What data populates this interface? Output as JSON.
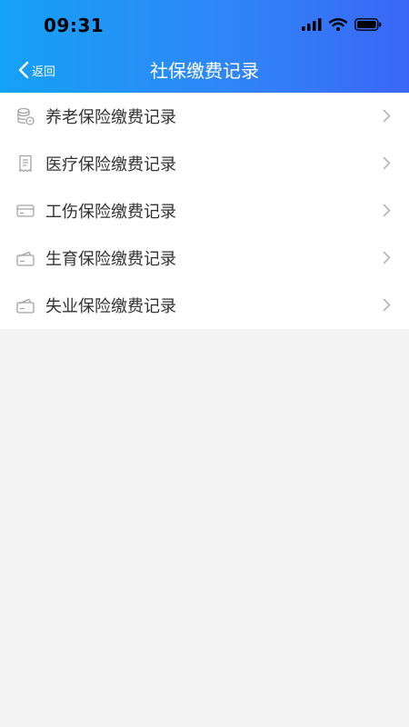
{
  "status_bar": {
    "time": "09:31",
    "icons": [
      "signal-icon",
      "wifi-icon",
      "battery-icon"
    ]
  },
  "navbar": {
    "back_label": "返回",
    "title": "社保缴费记录"
  },
  "colors": {
    "header_gradient_start": "#14a2f6",
    "header_gradient_end": "#3a67f7",
    "icon_gray": "#a3a3a3",
    "text_dark": "#333333",
    "background": "#f4f4f4"
  },
  "records": [
    {
      "icon": "coins-icon",
      "label": "养老保险缴费记录"
    },
    {
      "icon": "receipt-icon",
      "label": "医疗保险缴费记录"
    },
    {
      "icon": "card-icon",
      "label": "工伤保险缴费记录"
    },
    {
      "icon": "wallet-icon",
      "label": "生育保险缴费记录"
    },
    {
      "icon": "wallet-icon",
      "label": "失业保险缴费记录"
    }
  ]
}
